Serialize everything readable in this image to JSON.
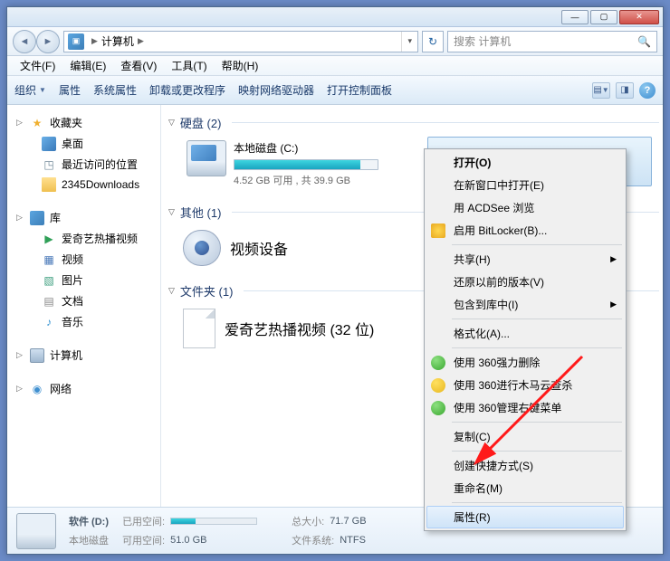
{
  "titlebar": {
    "min": "—",
    "max": "▢",
    "close": "✕"
  },
  "nav": {
    "back": "◄",
    "fwd": "►",
    "bc_icon": "▣",
    "bc_path": "计算机",
    "bc_sep": "▶",
    "refresh": "↻",
    "search_placeholder": "搜索 计算机",
    "search_icon": "🔍"
  },
  "menubar": {
    "file": "文件(F)",
    "edit": "编辑(E)",
    "view": "查看(V)",
    "tools": "工具(T)",
    "help": "帮助(H)"
  },
  "toolbar": {
    "organize": "组织",
    "properties": "属性",
    "sysProps": "系统属性",
    "uninstall": "卸载或更改程序",
    "mapDrive": "映射网络驱动器",
    "controlPanel": "打开控制面板",
    "help": "?"
  },
  "sidebar": {
    "favorites": "收藏夹",
    "desktop": "桌面",
    "recent": "最近访问的位置",
    "downloads": "2345Downloads",
    "libraries": "库",
    "iqiyi": "爱奇艺热播视频",
    "videos": "视频",
    "pictures": "图片",
    "documents": "文档",
    "music": "音乐",
    "computer": "计算机",
    "network": "网络"
  },
  "content": {
    "group_drives": "硬盘 (2)",
    "drive_c_name": "本地磁盘 (C:)",
    "drive_c_text": "4.52 GB 可用 , 共 39.9 GB",
    "drive_c_fill_pct": 88,
    "group_other": "其他 (1)",
    "device_name": "视频设备",
    "group_folders": "文件夹 (1)",
    "folder_name": "爱奇艺热播视频 (32 位)"
  },
  "context_menu": {
    "open": "打开(O)",
    "newWindow": "在新窗口中打开(E)",
    "acdsee": "用 ACDSee 浏览",
    "bitlocker": "启用 BitLocker(B)...",
    "share": "共享(H)",
    "restore": "还原以前的版本(V)",
    "includeLib": "包含到库中(I)",
    "format": "格式化(A)...",
    "del360": "使用 360强力删除",
    "scan360": "使用 360进行木马云查杀",
    "menu360": "使用 360管理右键菜单",
    "copy": "复制(C)",
    "shortcut": "创建快捷方式(S)",
    "rename": "重命名(M)",
    "properties": "属性(R)"
  },
  "statusbar": {
    "drive_name": "软件 (D:)",
    "drive_type": "本地磁盘",
    "used_label": "已用空间:",
    "free_label": "可用空间:",
    "free_value": "51.0 GB",
    "total_label": "总大小:",
    "total_value": "71.7 GB",
    "fs_label": "文件系统:",
    "fs_value": "NTFS",
    "used_pct": 29
  }
}
